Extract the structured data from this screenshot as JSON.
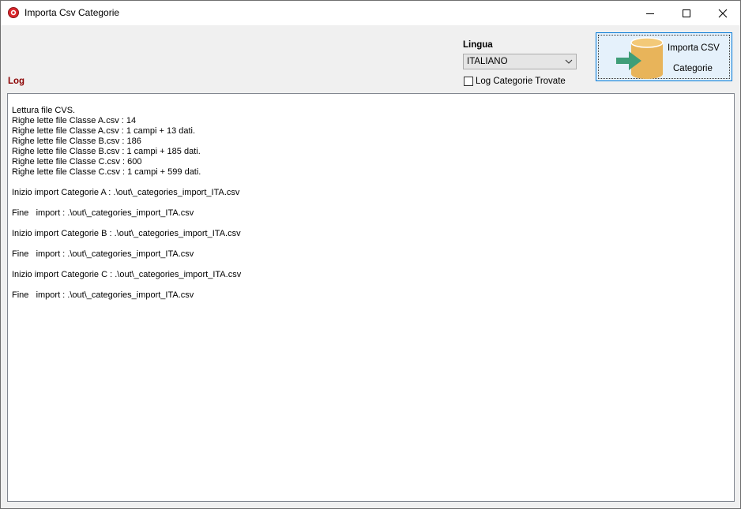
{
  "window": {
    "title": "Importa Csv Categorie",
    "icon": "app-red-circle-icon"
  },
  "lingua": {
    "label": "Lingua",
    "selected": "ITALIANO"
  },
  "options": {
    "log_categorie_trovate_label": "Log Categorie Trovate",
    "log_categorie_trovate_checked": false
  },
  "import_button": {
    "label_line1": "Importa CSV",
    "label_line2": "Categorie",
    "icon": "database-import-icon"
  },
  "log": {
    "label": "Log",
    "lines": [
      "Lettura file CVS.",
      "Righe lette file Classe A.csv : 14",
      "Righe lette file Classe A.csv : 1 campi + 13 dati.",
      "Righe lette file Classe B.csv : 186",
      "Righe lette file Classe B.csv : 1 campi + 185 dati.",
      "Righe lette file Classe C.csv : 600",
      "Righe lette file Classe C.csv : 1 campi + 599 dati.",
      "",
      "Inizio import Categorie A : .\\out\\_categories_import_ITA.csv",
      "",
      "Fine   import : .\\out\\_categories_import_ITA.csv",
      "",
      "Inizio import Categorie B : .\\out\\_categories_import_ITA.csv",
      "",
      "Fine   import : .\\out\\_categories_import_ITA.csv",
      "",
      "Inizio import Categorie C : .\\out\\_categories_import_ITA.csv",
      "",
      "Fine   import : .\\out\\_categories_import_ITA.csv"
    ]
  },
  "colors": {
    "log_label": "#8b0000",
    "button_border": "#0078d7",
    "button_bg": "#e5f1fb",
    "database": "#e8b45a",
    "arrow": "#3f9e78"
  }
}
